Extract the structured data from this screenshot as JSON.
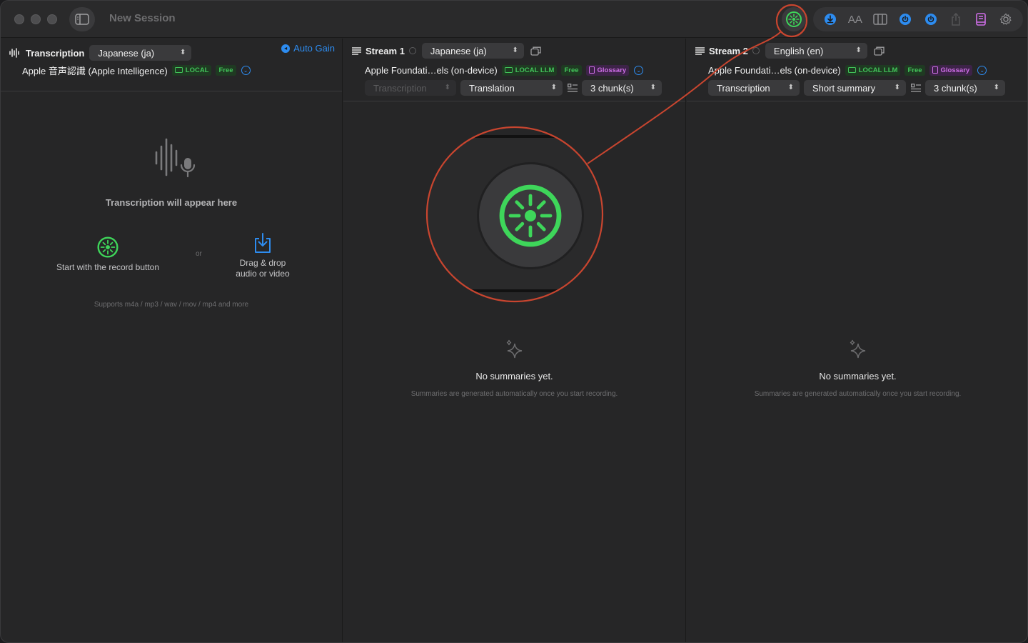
{
  "window": {
    "title": "New Session"
  },
  "toolbar": {
    "record_icon": "record-icon",
    "icons": [
      "download-icon",
      "font-size-icon",
      "columns-icon",
      "power-icon",
      "power-icon",
      "share-icon",
      "book-icon",
      "gear-icon"
    ],
    "font_size_label": "AA"
  },
  "transcription": {
    "title": "Transcription",
    "language": "Japanese (ja)",
    "auto_gain": "Auto Gain",
    "model": "Apple 音声認識 (Apple Intelligence)",
    "badge_local": "LOCAL",
    "badge_free": "Free",
    "empty_title": "Transcription will appear here",
    "record_hint": "Start with the record button",
    "or": "or",
    "drop_hint_1": "Drag & drop",
    "drop_hint_2": "audio or video",
    "supports": "Supports m4a / mp3 / wav / mov / mp4 and more"
  },
  "stream1": {
    "title": "Stream 1",
    "language": "Japanese (ja)",
    "model": "Apple Foundati…els (on-device)",
    "badge_local": "LOCAL LLM",
    "badge_free": "Free",
    "badge_glossary": "Glossary",
    "source": "Transcription",
    "mode": "Translation",
    "chunks": "3 chunk(s)",
    "empty_title": "No summaries yet.",
    "empty_sub": "Summaries are generated automatically once you start recording."
  },
  "stream2": {
    "title": "Stream 2",
    "language": "English (en)",
    "model": "Apple Foundati…els (on-device)",
    "badge_local": "LOCAL LLM",
    "badge_free": "Free",
    "badge_glossary": "Glossary",
    "source": "Transcription",
    "mode": "Short summary",
    "chunks": "3 chunk(s)",
    "empty_title": "No summaries yet.",
    "empty_sub": "Summaries are generated automatically once you start recording."
  },
  "colors": {
    "accent_blue": "#2d8cf0",
    "record_green": "#3ed65a",
    "annotation_red": "#c8452f",
    "glossary_purple": "#cf6ee8"
  }
}
